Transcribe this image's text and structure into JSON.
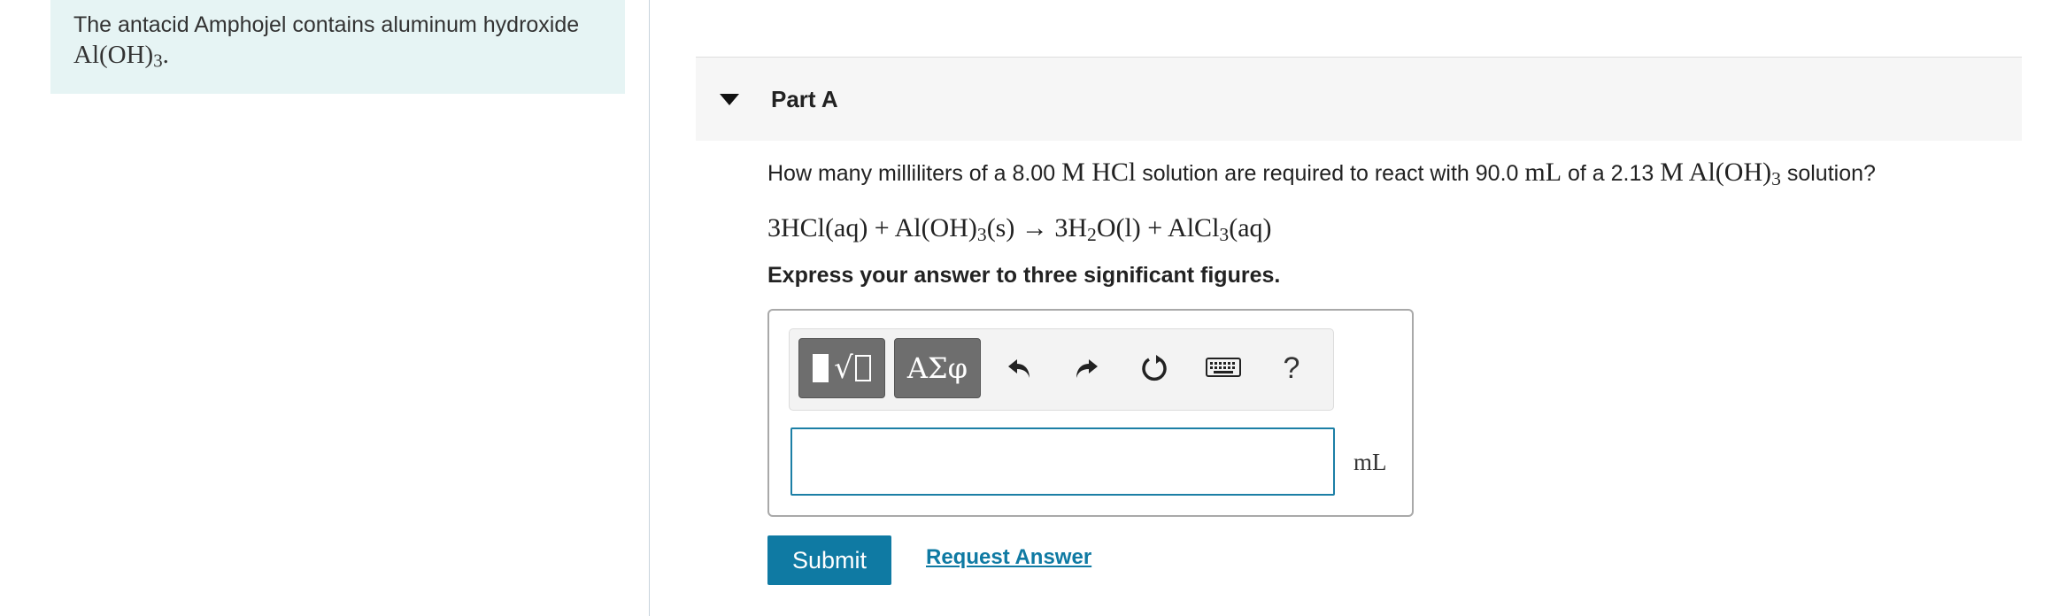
{
  "info": {
    "line1": "The antacid Amphojel contains aluminum hydroxide",
    "formula_main": "Al(OH)",
    "formula_sub": "3",
    "formula_end": "."
  },
  "part": {
    "title": "Part A"
  },
  "question": {
    "t1": "How many milliliters of a 8.00 ",
    "m1": "M HCl",
    "t2": " solution are required to react with 90.0 ",
    "m2": "mL",
    "t3": " of a 2.13 ",
    "m3": "M Al(OH)",
    "m3_sub": "3",
    "t4": " solution?"
  },
  "equation": {
    "p1": "3HCl(aq) + Al(OH)",
    "s1": "3",
    "p2": "(s) → 3H",
    "s2": "2",
    "p3": "O(l) + AlCl",
    "s3": "3",
    "p4": "(aq)"
  },
  "instruction": "Express your answer to three significant figures.",
  "toolbar": {
    "templates_icon": "templates-icon",
    "symbols_label": "ΑΣφ",
    "help_label": "?"
  },
  "answer": {
    "value": "",
    "unit": "mL"
  },
  "actions": {
    "submit_label": "Submit",
    "request_label": "Request Answer"
  },
  "colors": {
    "accent": "#0f7aa3",
    "info_bg": "#e6f4f4",
    "header_bg": "#f6f6f6"
  }
}
